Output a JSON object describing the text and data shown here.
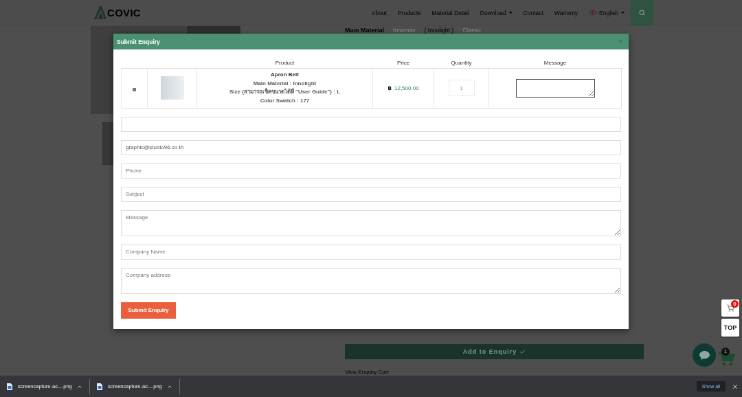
{
  "navbar": {
    "logo_text": "COVIC",
    "items": [
      {
        "label": "About",
        "dropdown": false
      },
      {
        "label": "Products",
        "dropdown": false
      },
      {
        "label": "Material Detail",
        "dropdown": false
      },
      {
        "label": "Download",
        "dropdown": true
      },
      {
        "label": "Contact",
        "dropdown": false
      },
      {
        "label": "Warranty",
        "dropdown": false
      }
    ],
    "language": {
      "label": "English",
      "dropdown": true
    }
  },
  "product_page": {
    "material": {
      "label": "Main Material",
      "options": [
        {
          "label": "Innomax",
          "selected": false
        },
        {
          "label": "( Innolight )",
          "selected": true
        },
        {
          "label": "Classic",
          "selected": false
        }
      ]
    },
    "add_button": "Add to Enquiry",
    "cart_link": "View Enquiry Cart"
  },
  "modal": {
    "title": "Submit Enquiry",
    "table": {
      "columns": [
        {
          "kind": "remove"
        },
        {
          "kind": "image"
        },
        {
          "kind": "product",
          "label": "Product"
        },
        {
          "kind": "price",
          "label": "Price"
        },
        {
          "kind": "quantity",
          "label": "Quantity"
        },
        {
          "kind": "message",
          "label": "Message"
        }
      ],
      "rows": [
        {
          "name": "Apron Belt",
          "details": [
            "Main Material : Innolight",
            "Size (สามารถเช็คขนาดได้ที่ \"User Guide\") : L",
            "Color Swatch : 177"
          ],
          "currency": "฿",
          "price": "12,500.00",
          "quantity": "1"
        }
      ]
    },
    "fields": [
      {
        "kind": "input"
      },
      {
        "kind": "input",
        "value": "graphic@studio96.co.th"
      },
      {
        "kind": "input",
        "placeholder": "Phone"
      },
      {
        "kind": "input",
        "placeholder": "Subject"
      },
      {
        "kind": "textarea",
        "placeholder": "Message"
      },
      {
        "kind": "input",
        "placeholder": "Company Name"
      },
      {
        "kind": "textarea",
        "placeholder": "Company address"
      }
    ],
    "submit_button": "Submit Enquiry"
  },
  "floating": {
    "cart_badge": "0",
    "top_label": "TOP",
    "chat_cart_badge": "1"
  },
  "downloads": {
    "items": [
      {
        "filename": "screencapture-ac....png"
      },
      {
        "filename": "screencapture-ac....png"
      }
    ],
    "show_all": "Show all"
  }
}
